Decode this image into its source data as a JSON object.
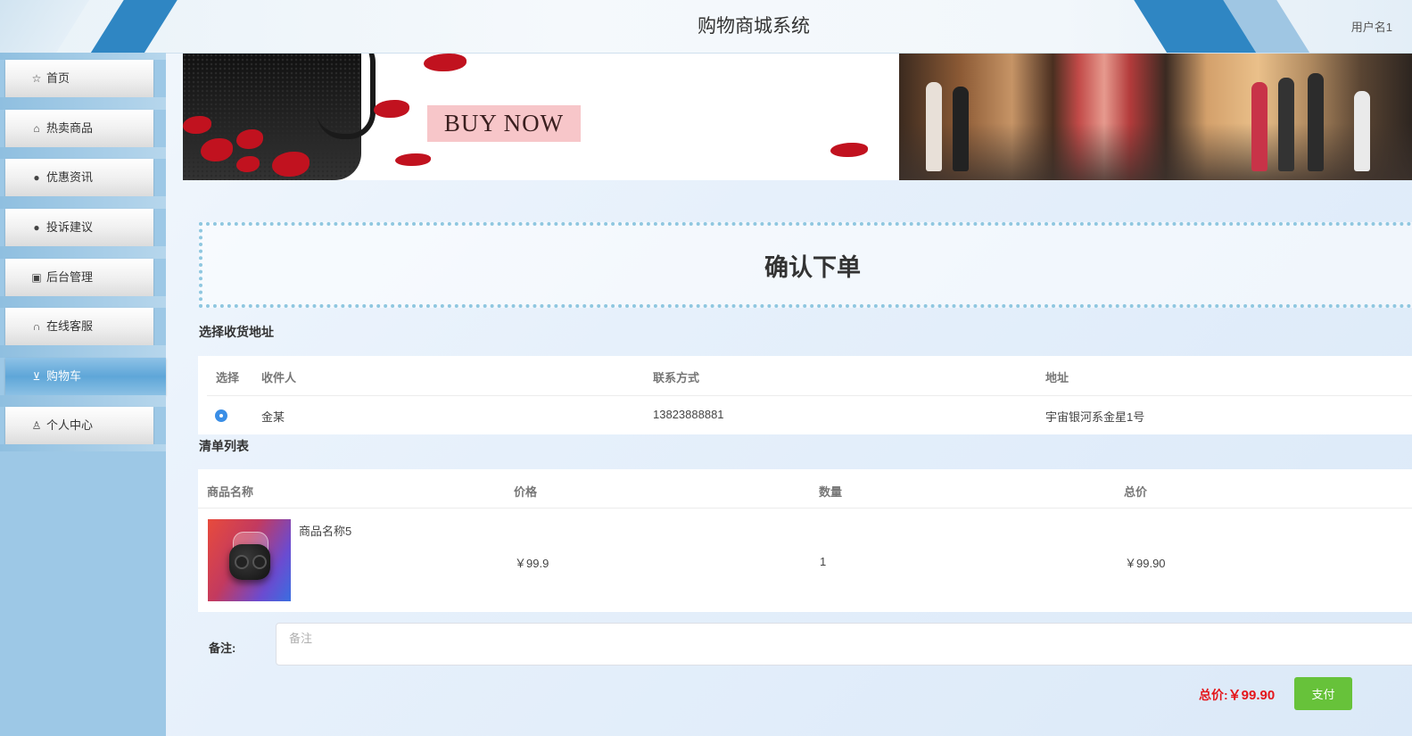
{
  "header": {
    "title": "购物商城系统",
    "user": "用户名1"
  },
  "sidebar": {
    "items": [
      {
        "label": "首页",
        "icon": "star-icon",
        "glyph": "☆",
        "active": false
      },
      {
        "label": "热卖商品",
        "icon": "shopping-bag-icon",
        "glyph": "🛍",
        "active": false
      },
      {
        "label": "优惠资讯",
        "icon": "info-circle-icon",
        "glyph": "❗",
        "active": false
      },
      {
        "label": "投诉建议",
        "icon": "question-circle-icon",
        "glyph": "❓",
        "active": false
      },
      {
        "label": "后台管理",
        "icon": "gift-icon",
        "glyph": "🎁",
        "active": false
      },
      {
        "label": "在线客服",
        "icon": "headset-icon",
        "glyph": "🎧",
        "active": false
      },
      {
        "label": "购物车",
        "icon": "cart-icon",
        "glyph": "🛒",
        "active": true
      },
      {
        "label": "个人中心",
        "icon": "user-icon",
        "glyph": "👤",
        "active": false
      }
    ]
  },
  "banner": {
    "cta_text": "BUY NOW"
  },
  "page": {
    "title": "确认下单"
  },
  "address": {
    "section_title": "选择收货地址",
    "columns": [
      "选择",
      "收件人",
      "联系方式",
      "地址"
    ],
    "rows": [
      {
        "selected": true,
        "name": "金某",
        "phone": "13823888881",
        "address": "宇宙银河系金星1号"
      }
    ]
  },
  "order": {
    "section_title": "清单列表",
    "columns": [
      "商品名称",
      "价格",
      "数量",
      "总价"
    ],
    "items": [
      {
        "name": "商品名称5",
        "price": "￥99.9",
        "quantity": "1",
        "subtotal": "￥99.90"
      }
    ]
  },
  "remark": {
    "label": "备注:",
    "placeholder": "备注",
    "value": ""
  },
  "footer": {
    "total_label": "总价:",
    "total_amount": "￥99.90",
    "pay_button": "支付"
  },
  "colors": {
    "accent": "#2f86c3",
    "sidebar_bg": "#9dc8e6",
    "pay_button": "#67c23a",
    "total_text": "#e4161b",
    "radio": "#3a8ee6"
  }
}
